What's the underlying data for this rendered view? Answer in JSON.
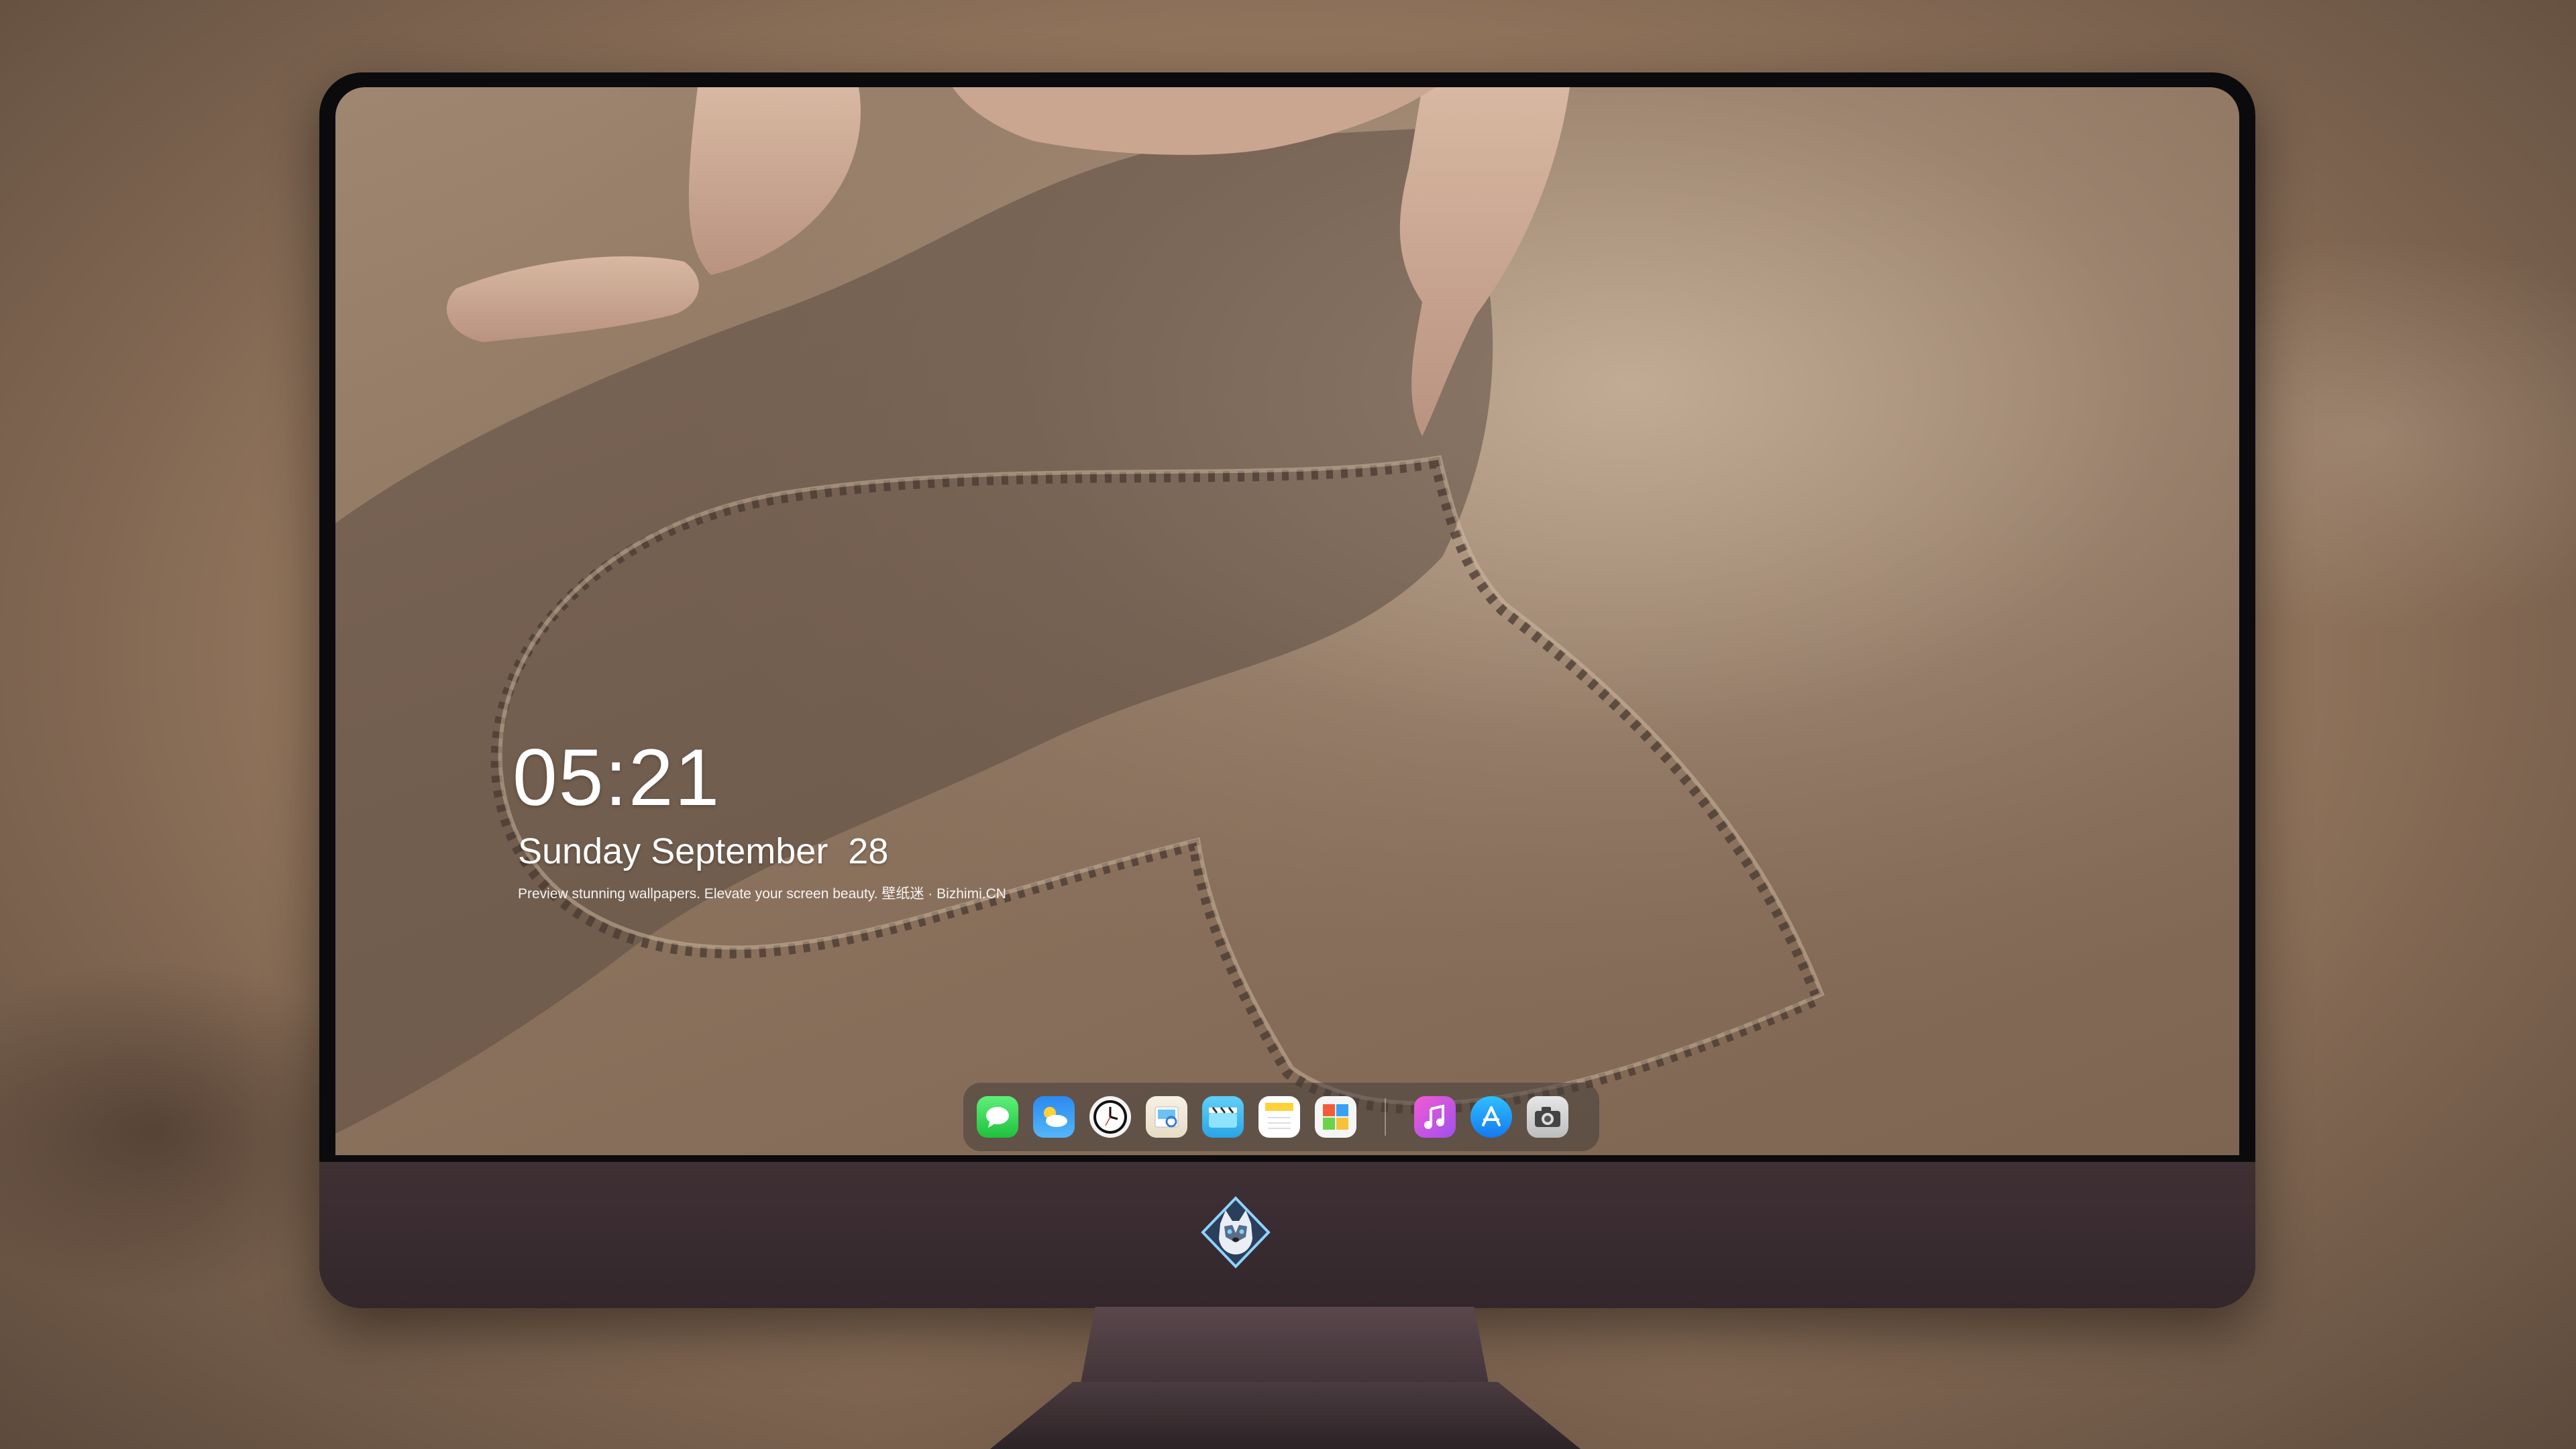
{
  "lockscreen": {
    "time": "05:21",
    "date": "Sunday September  28",
    "tagline": "Preview stunning wallpapers. Elevate your screen beauty. 壁纸迷 · Bizhimi.CN"
  },
  "dock": {
    "apps": [
      {
        "icon": "messages-icon"
      },
      {
        "icon": "weather-icon"
      },
      {
        "icon": "clock-icon"
      },
      {
        "icon": "preview-icon"
      },
      {
        "icon": "clips-icon"
      },
      {
        "icon": "notes-icon"
      },
      {
        "icon": "photo-booth-icon"
      },
      {
        "icon": "itunes-icon"
      },
      {
        "icon": "app-store-icon"
      },
      {
        "icon": "camera-icon"
      }
    ]
  },
  "monitor": {
    "logo": "husky-mascot-logo"
  }
}
